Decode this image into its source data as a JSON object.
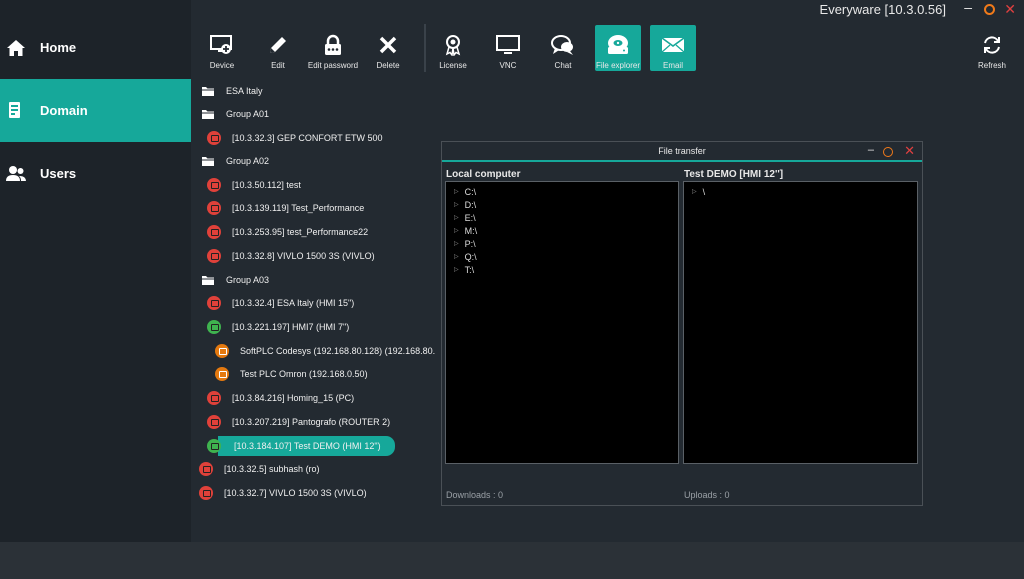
{
  "window": {
    "title": "Everyware [10.3.0.56]"
  },
  "sidebar": {
    "items": [
      {
        "label": "Home",
        "icon": "home-icon"
      },
      {
        "label": "Domain",
        "icon": "domain-icon",
        "active": true
      },
      {
        "label": "Users",
        "icon": "users-icon"
      }
    ]
  },
  "toolbar": {
    "buttons": [
      {
        "label": "Device",
        "icon": "device-icon"
      },
      {
        "label": "Edit",
        "icon": "pencil-icon"
      },
      {
        "label": "Edit password",
        "icon": "lock-icon"
      },
      {
        "label": "Delete",
        "icon": "close-icon"
      },
      {
        "label": "License",
        "icon": "license-icon"
      },
      {
        "label": "VNC",
        "icon": "monitor-icon"
      },
      {
        "label": "Chat",
        "icon": "chat-icon"
      },
      {
        "label": "File explorer",
        "icon": "drive-icon",
        "active": true
      },
      {
        "label": "Email",
        "icon": "mail-icon",
        "active": true
      },
      {
        "label": "Refresh",
        "icon": "refresh-icon"
      }
    ]
  },
  "tree": {
    "nodes": [
      {
        "label": "ESA Italy",
        "type": "folder"
      },
      {
        "label": "Group A01",
        "type": "folder"
      },
      {
        "label": "[10.3.32.3] GEP CONFORT ETW 500",
        "type": "device",
        "status": "red"
      },
      {
        "label": "Group A02",
        "type": "folder"
      },
      {
        "label": "[10.3.50.112] test",
        "type": "device",
        "status": "red"
      },
      {
        "label": "[10.3.139.119] Test_Performance",
        "type": "device",
        "status": "red"
      },
      {
        "label": "[10.3.253.95] test_Performance22",
        "type": "device",
        "status": "red"
      },
      {
        "label": "[10.3.32.8] VIVLO 1500 3S   (VIVLO)",
        "type": "device",
        "status": "red"
      },
      {
        "label": "Group A03",
        "type": "folder"
      },
      {
        "label": "[10.3.32.4] ESA Italy   (HMI 15\")",
        "type": "device",
        "status": "red"
      },
      {
        "label": "[10.3.221.197] HMI7   (HMI 7\")",
        "type": "device",
        "status": "green"
      },
      {
        "label": "SoftPLC Codesys (192.168.80.128) (192.168.80.",
        "type": "plc",
        "status": "orange"
      },
      {
        "label": "Test PLC Omron (192.168.0.50)",
        "type": "plc",
        "status": "orange"
      },
      {
        "label": "[10.3.84.216] Homing_15   (PC)",
        "type": "device",
        "status": "red"
      },
      {
        "label": "[10.3.207.219] Pantografo   (ROUTER 2)",
        "type": "device",
        "status": "red"
      },
      {
        "label": "[10.3.184.107] Test DEMO   (HMI 12\")",
        "type": "device",
        "status": "green",
        "selected": true
      },
      {
        "label": "[10.3.32.5] subhash   (ro)",
        "type": "device",
        "status": "red"
      },
      {
        "label": "[10.3.32.7] VIVLO 1500 3S   (VIVLO)",
        "type": "device",
        "status": "red"
      }
    ]
  },
  "file_transfer": {
    "title": "File transfer",
    "local_heading": "Local computer",
    "remote_heading": "Test DEMO [HMI 12'']",
    "local_drives": [
      "C:\\",
      "D:\\",
      "E:\\",
      "M:\\",
      "P:\\",
      "Q:\\",
      "T:\\"
    ],
    "remote_items": [
      "\\"
    ],
    "downloads": "Downloads : 0",
    "uploads": "Uploads : 0"
  },
  "colors": {
    "accent": "#16a89a",
    "background": "#232a31",
    "sidebar": "#1d2329",
    "status_red": "#e0413a",
    "status_green": "#3fb34f",
    "status_orange": "#e4790f"
  }
}
